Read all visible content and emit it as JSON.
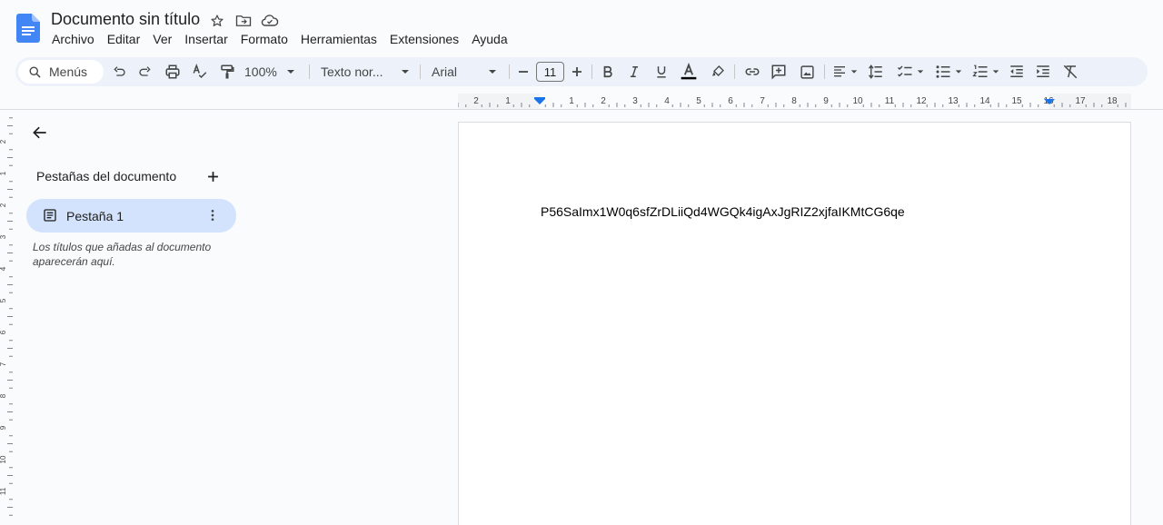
{
  "header": {
    "title": "Documento sin título",
    "menus": [
      "Archivo",
      "Editar",
      "Ver",
      "Insertar",
      "Formato",
      "Herramientas",
      "Extensiones",
      "Ayuda"
    ]
  },
  "toolbar": {
    "search_label": "Menús",
    "zoom": "100%",
    "style": "Texto nor...",
    "font": "Arial",
    "font_size": "11"
  },
  "ruler": {
    "labels": [
      "2",
      "1",
      "1",
      "2",
      "3",
      "4",
      "5",
      "6",
      "7",
      "8",
      "9",
      "10",
      "11",
      "12",
      "13",
      "14",
      "15",
      "16",
      "17",
      "18"
    ]
  },
  "sidebar": {
    "heading": "Pestañas del documento",
    "tabs": [
      {
        "label": "Pestaña 1"
      }
    ],
    "hint": "Los títulos que añadas al documento aparecerán aquí."
  },
  "document": {
    "body_text": "P56SaImx1W0q6sfZrDLiiQd4WGQk4igAxJgRIZ2xjfaIKMtCG6qe"
  },
  "colors": {
    "accent": "#1a73e8",
    "toolbar_bg": "#edf2fa",
    "selected_tab": "#d3e3fd",
    "text_color_bar": "#000000"
  }
}
